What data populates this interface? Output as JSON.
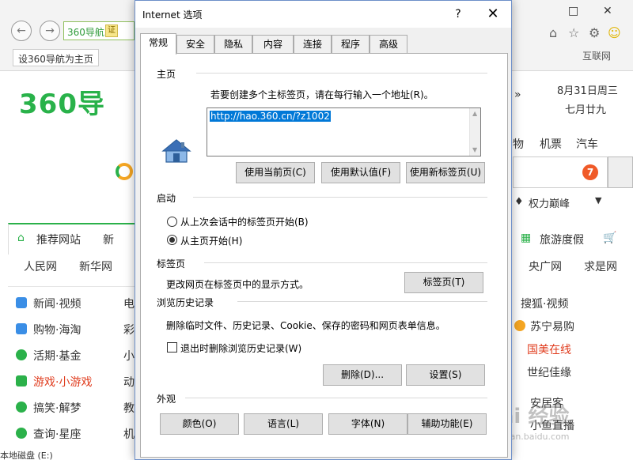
{
  "browser": {
    "back_icon": "arrow-left-icon",
    "forward_icon": "arrow-right-icon",
    "address_label": "360导航",
    "cert_label": "证",
    "tab_label": "设360导航为主页",
    "right_top_label": "互联网",
    "logo": "360导",
    "date": "8月31日周三",
    "lunar": "七月廿九",
    "top_links": [
      "物",
      "机票",
      "汽车"
    ],
    "badge_count": "7",
    "quanli": "权力巅峰",
    "recommend_tab": "推荐网站",
    "news_tab": "新",
    "travel": "旅游度假",
    "links_row": [
      "人民网",
      "新华网",
      "央广网",
      "求是网"
    ],
    "categories_left": [
      "新闻·视频",
      "购物·海淘",
      "活期·基金",
      "游戏·小游戏",
      "搞笑·解梦",
      "查询·星座"
    ],
    "categories_mid": [
      "电",
      "彩",
      "小",
      "动",
      "教",
      "机"
    ],
    "right_list": [
      "搜狐·视频",
      "苏宁易购",
      "国美在线",
      "世纪佳缘",
      "安居客",
      "小鱼直播"
    ],
    "status_bar": "本地磁盘 (E:)",
    "watermark": "Bai 经验",
    "watermark_url": "jingyan.baidu.com"
  },
  "dialog": {
    "title": "Internet 选项",
    "help": "?",
    "close": "✕",
    "tabs": [
      {
        "label": "常规",
        "active": true
      },
      {
        "label": "安全"
      },
      {
        "label": "隐私"
      },
      {
        "label": "内容"
      },
      {
        "label": "连接"
      },
      {
        "label": "程序"
      },
      {
        "label": "高级"
      }
    ],
    "homepage": {
      "header": "主页",
      "icon": "home-icon",
      "instruction": "若要创建多个主标签页，请在每行输入一个地址(R)。",
      "url": "http://hao.360.cn/?z1002",
      "btn_current": "使用当前页(C)",
      "btn_default": "使用默认值(F)",
      "btn_newtab": "使用新标签页(U)"
    },
    "startup": {
      "header": "启动",
      "option_last_session": "从上次会话中的标签页开始(B)",
      "option_homepage": "从主页开始(H)",
      "selected": "option_homepage"
    },
    "tabs_section": {
      "header": "标签页",
      "desc": "更改网页在标签页中的显示方式。",
      "btn": "标签页(T)"
    },
    "history": {
      "header": "浏览历史记录",
      "desc": "删除临时文件、历史记录、Cookie、保存的密码和网页表单信息。",
      "checkbox_label": "退出时删除浏览历史记录(W)",
      "checked": false,
      "btn_delete": "删除(D)...",
      "btn_settings": "设置(S)"
    },
    "appearance": {
      "header": "外观",
      "btn_colors": "颜色(O)",
      "btn_languages": "语言(L)",
      "btn_fonts": "字体(N)",
      "btn_accessibility": "辅助功能(E)"
    }
  },
  "colors": {
    "accent": "#0078d7",
    "brand_green": "#2bb14a"
  }
}
